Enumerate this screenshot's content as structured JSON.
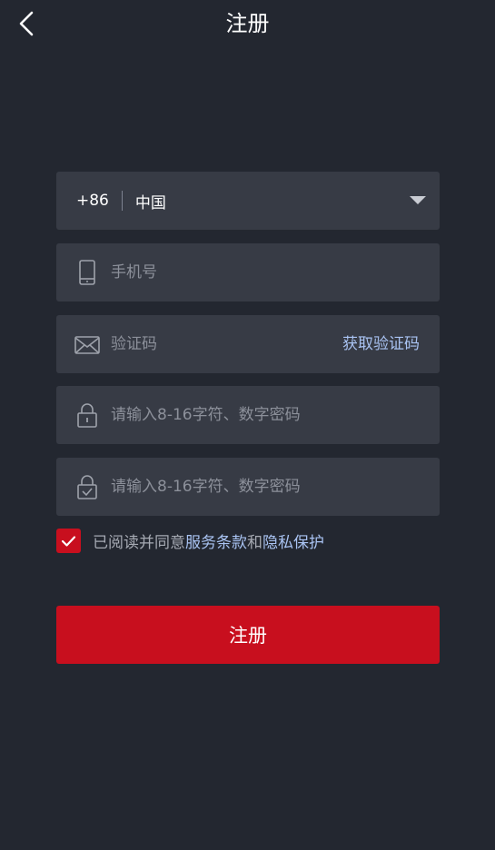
{
  "header": {
    "title": "注册",
    "back_icon": "chevron-left-icon"
  },
  "country": {
    "code": "+86",
    "name": "中国",
    "icon": "caret-down-icon"
  },
  "phone": {
    "placeholder": "手机号",
    "value": "",
    "icon": "mobile-phone-icon"
  },
  "verification": {
    "placeholder": "验证码",
    "value": "",
    "icon": "envelope-icon",
    "get_code_label": "获取验证码"
  },
  "password": {
    "placeholder": "请输入8-16字符、数字密码",
    "value": "",
    "icon": "lock-icon"
  },
  "confirm_password": {
    "placeholder": "请输入8-16字符、数字密码",
    "value": "",
    "icon": "lock-check-icon"
  },
  "agreement": {
    "checked": true,
    "prefix": "已阅读并同意",
    "terms_label": "服务条款",
    "conjunction": "和",
    "privacy_label": "隐私保护"
  },
  "submit": {
    "label": "注册"
  },
  "colors": {
    "background": "#232730",
    "field": "#373b45",
    "accent_red": "#c80f1e",
    "link_blue": "#a9c3f2",
    "placeholder": "#8c909a"
  }
}
